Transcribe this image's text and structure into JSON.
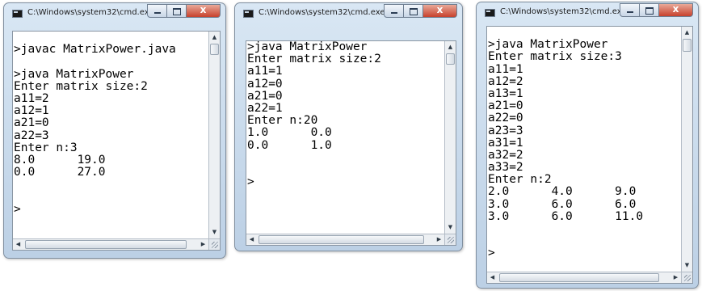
{
  "windows": [
    {
      "title": "C:\\Windows\\system32\\cmd.exe",
      "close_glyph": "x",
      "lines": [
        "",
        ">javac MatrixPower.java",
        "",
        ">java MatrixPower",
        "Enter matrix size:2",
        "a11=2",
        "a12=1",
        "a21=0",
        "a22=3",
        "Enter n:3",
        "8.0      19.0",
        "0.0      27.0",
        "",
        "",
        ">"
      ]
    },
    {
      "title": "C:\\Windows\\system32\\cmd.exe",
      "close_glyph": "x",
      "lines": [
        ">java MatrixPower",
        "Enter matrix size:2",
        "a11=1",
        "a12=0",
        "a21=0",
        "a22=1",
        "Enter n:20",
        "1.0      0.0",
        "0.0      1.0",
        "",
        "",
        ">"
      ]
    },
    {
      "title": "C:\\Windows\\system32\\cmd.exe",
      "close_glyph": "x",
      "lines": [
        "",
        ">java MatrixPower",
        "Enter matrix size:3",
        "a11=1",
        "a12=2",
        "a13=1",
        "a21=0",
        "a22=0",
        "a23=3",
        "a31=1",
        "a32=2",
        "a33=2",
        "Enter n:2",
        "2.0      4.0      9.0",
        "3.0      6.0      6.0",
        "3.0      6.0      11.0",
        "",
        "",
        ">"
      ]
    }
  ],
  "icons": {
    "app": "console-window-icon",
    "minimize": "minimize-icon",
    "maximize": "maximize-icon",
    "close": "close-icon",
    "scroll_up": "up-arrow-icon",
    "scroll_down": "down-arrow-icon",
    "scroll_left": "left-arrow-icon",
    "scroll_right": "right-arrow-icon",
    "grip": "resize-grip-icon"
  },
  "colors": {
    "close_button": "#c7412c",
    "console_bg": "#ffffff",
    "console_text": "#000000",
    "frame": "#bcd0e5"
  }
}
